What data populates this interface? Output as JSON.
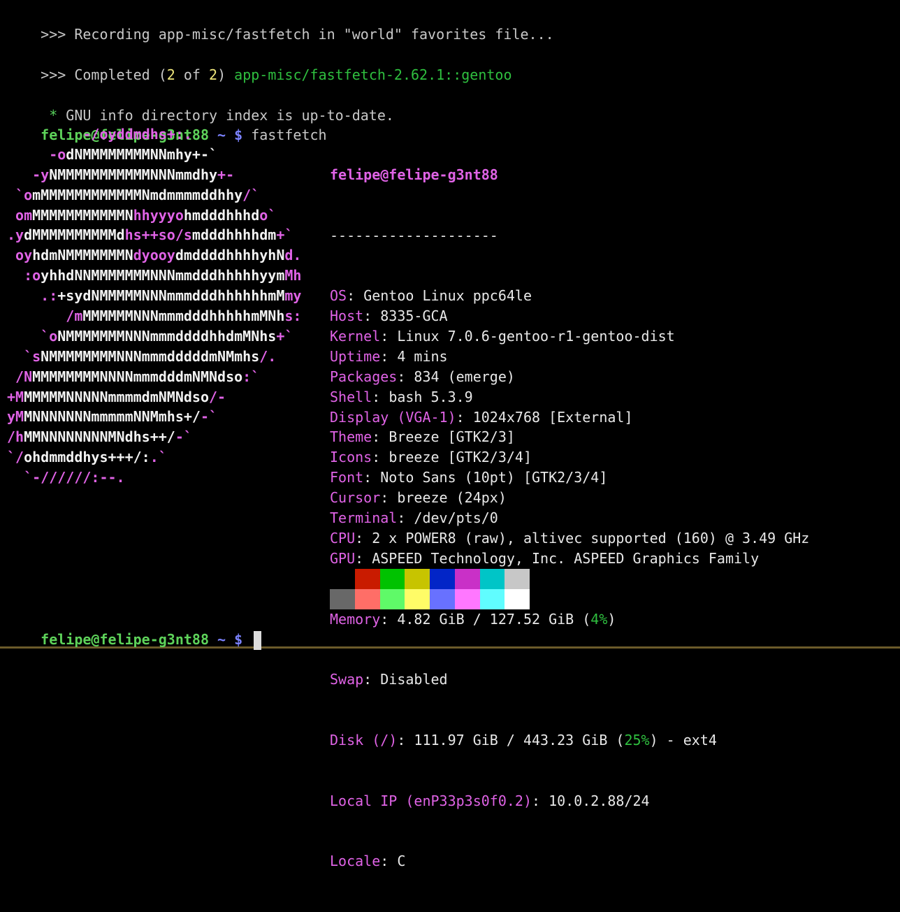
{
  "lines": {
    "recording": ">>> Recording app-misc/fastfetch in \"world\" favorites file...",
    "completed_prefix": ">>> Completed (",
    "completed_n": "2",
    "completed_of": " of ",
    "completed_total": "2",
    "completed_close": ") ",
    "completed_pkg": "app-misc/fastfetch-2.62.1::gentoo",
    "info_star": " * ",
    "info_text": "GNU info directory index is up-to-date."
  },
  "prompt": {
    "user_host": "felipe@felipe-g3nt88",
    "path_symbol": " ~ $ ",
    "command": "fastfetch"
  },
  "logo_rows": [
    [
      [
        "m",
        "         -/oyddmdhs+:."
      ]
    ],
    [
      [
        "m",
        "     -o"
      ],
      [
        "w",
        "dNMMMMMMMMNNmhy+-`"
      ]
    ],
    [
      [
        "m",
        "   -y"
      ],
      [
        "w",
        "NMMMMMMMMMMMNNNmmdhy"
      ],
      [
        "m",
        "+-"
      ]
    ],
    [
      [
        "m",
        " `o"
      ],
      [
        "w",
        "mMMMMMMMMMMMMNmdmmmmddhhy"
      ],
      [
        "m",
        "/`"
      ]
    ],
    [
      [
        "m",
        " om"
      ],
      [
        "w",
        "MMMMMMMMMMMN"
      ],
      [
        "m",
        "hhyyyo"
      ],
      [
        "w",
        "hmdddhhhd"
      ],
      [
        "m",
        "o`"
      ]
    ],
    [
      [
        "m",
        ".y"
      ],
      [
        "w",
        "dMMMMMMMMMMd"
      ],
      [
        "m",
        "hs++so/s"
      ],
      [
        "w",
        "mdddhhhhdm"
      ],
      [
        "m",
        "+`"
      ]
    ],
    [
      [
        "m",
        " oy"
      ],
      [
        "w",
        "hdmNMMMMMMMN"
      ],
      [
        "m",
        "dyooy"
      ],
      [
        "w",
        "dmddddhhhhyhN"
      ],
      [
        "m",
        "d."
      ]
    ],
    [
      [
        "m",
        "  :o"
      ],
      [
        "w",
        "yhhdNNMMMMMMMNNNmmdddhhhhhyym"
      ],
      [
        "m",
        "Mh"
      ]
    ],
    [
      [
        "m",
        "    .:"
      ],
      [
        "w",
        "+sydNMMMMMNNNmmmdddhhhhhhmM"
      ],
      [
        "m",
        "my"
      ]
    ],
    [
      [
        "m",
        "       /m"
      ],
      [
        "w",
        "MMMMMMNNNmmmdddhhhhhmMNh"
      ],
      [
        "m",
        "s:"
      ]
    ],
    [
      [
        "m",
        "    `o"
      ],
      [
        "w",
        "NMMMMMMMNNNmmmddddhhdmMNhs"
      ],
      [
        "m",
        "+`"
      ]
    ],
    [
      [
        "m",
        "  `s"
      ],
      [
        "w",
        "NMMMMMMMMNNNmmmdddddmNMmhs"
      ],
      [
        "m",
        "/."
      ]
    ],
    [
      [
        "m",
        " /N"
      ],
      [
        "w",
        "MMMMMMMMNNNNmmmdddmNMNdso"
      ],
      [
        "m",
        ":`"
      ]
    ],
    [
      [
        "m",
        "+M"
      ],
      [
        "w",
        "MMMMMNNNNNmmmmdmNMNdso"
      ],
      [
        "m",
        "/-"
      ]
    ],
    [
      [
        "m",
        "yM"
      ],
      [
        "w",
        "MNNNNNNNmmmmmNNMmhs+/"
      ],
      [
        "m",
        "-`"
      ]
    ],
    [
      [
        "m",
        "/h"
      ],
      [
        "w",
        "MMNNNNNNNNMNdhs++/"
      ],
      [
        "m",
        "-`"
      ]
    ],
    [
      [
        "m",
        "`/"
      ],
      [
        "w",
        "ohdmmddhys+++/:"
      ],
      [
        "m",
        ".`"
      ]
    ],
    [
      [
        "m",
        "  `-//////:--."
      ]
    ]
  ],
  "info": {
    "title": "felipe@felipe-g3nt88",
    "separator": "--------------------",
    "rows": [
      {
        "key": "OS",
        "value": "Gentoo Linux ppc64le"
      },
      {
        "key": "Host",
        "value": "8335-GCA"
      },
      {
        "key": "Kernel",
        "value": "Linux 7.0.6-gentoo-r1-gentoo-dist"
      },
      {
        "key": "Uptime",
        "value": "4 mins"
      },
      {
        "key": "Packages",
        "value": "834 (emerge)"
      },
      {
        "key": "Shell",
        "value": "bash 5.3.9"
      },
      {
        "key": "Display (VGA-1)",
        "value": "1024x768 [External]"
      },
      {
        "key": "Theme",
        "value": "Breeze [GTK2/3]"
      },
      {
        "key": "Icons",
        "value": "breeze [GTK2/3/4]"
      },
      {
        "key": "Font",
        "value": "Noto Sans (10pt) [GTK2/3/4]"
      },
      {
        "key": "Cursor",
        "value": "breeze (24px)"
      },
      {
        "key": "Terminal",
        "value": "/dev/pts/0"
      },
      {
        "key": "CPU",
        "value": "2 x POWER8 (raw), altivec supported (160) @ 3.49 GHz"
      },
      {
        "key": "GPU",
        "value": "ASPEED Technology, Inc. ASPEED Graphics Family"
      }
    ],
    "memory": {
      "key": "Memory",
      "pre": "4.82 GiB / 127.52 GiB (",
      "pct": "4%",
      "post": ")"
    },
    "swap": {
      "key": "Swap",
      "value": "Disabled"
    },
    "disk": {
      "key": "Disk (/)",
      "pre": "111.97 GiB / 443.23 GiB (",
      "pct": "25%",
      "post": ") - ext4"
    },
    "local_ip": {
      "key": "Local IP (enP33p3s0f0.2)",
      "value": "10.0.2.88/24"
    },
    "locale": {
      "key": "Locale",
      "value": "C"
    }
  },
  "palette": {
    "normal": [
      "#000000",
      "#c91b00",
      "#00c200",
      "#c7c400",
      "#0225c7",
      "#c930c7",
      "#00c5c7",
      "#c7c7c7"
    ],
    "bright": [
      "#686868",
      "#ff6e67",
      "#5ffa68",
      "#fffc67",
      "#6871ff",
      "#ff77ff",
      "#60fdff",
      "#ffffff"
    ]
  },
  "colors": {
    "background": "#000000",
    "prompt_user": "#5ed35a",
    "prompt_path": "#7b82ff",
    "info_key": "#e063e6",
    "pct_green": "#2fbf3f"
  }
}
